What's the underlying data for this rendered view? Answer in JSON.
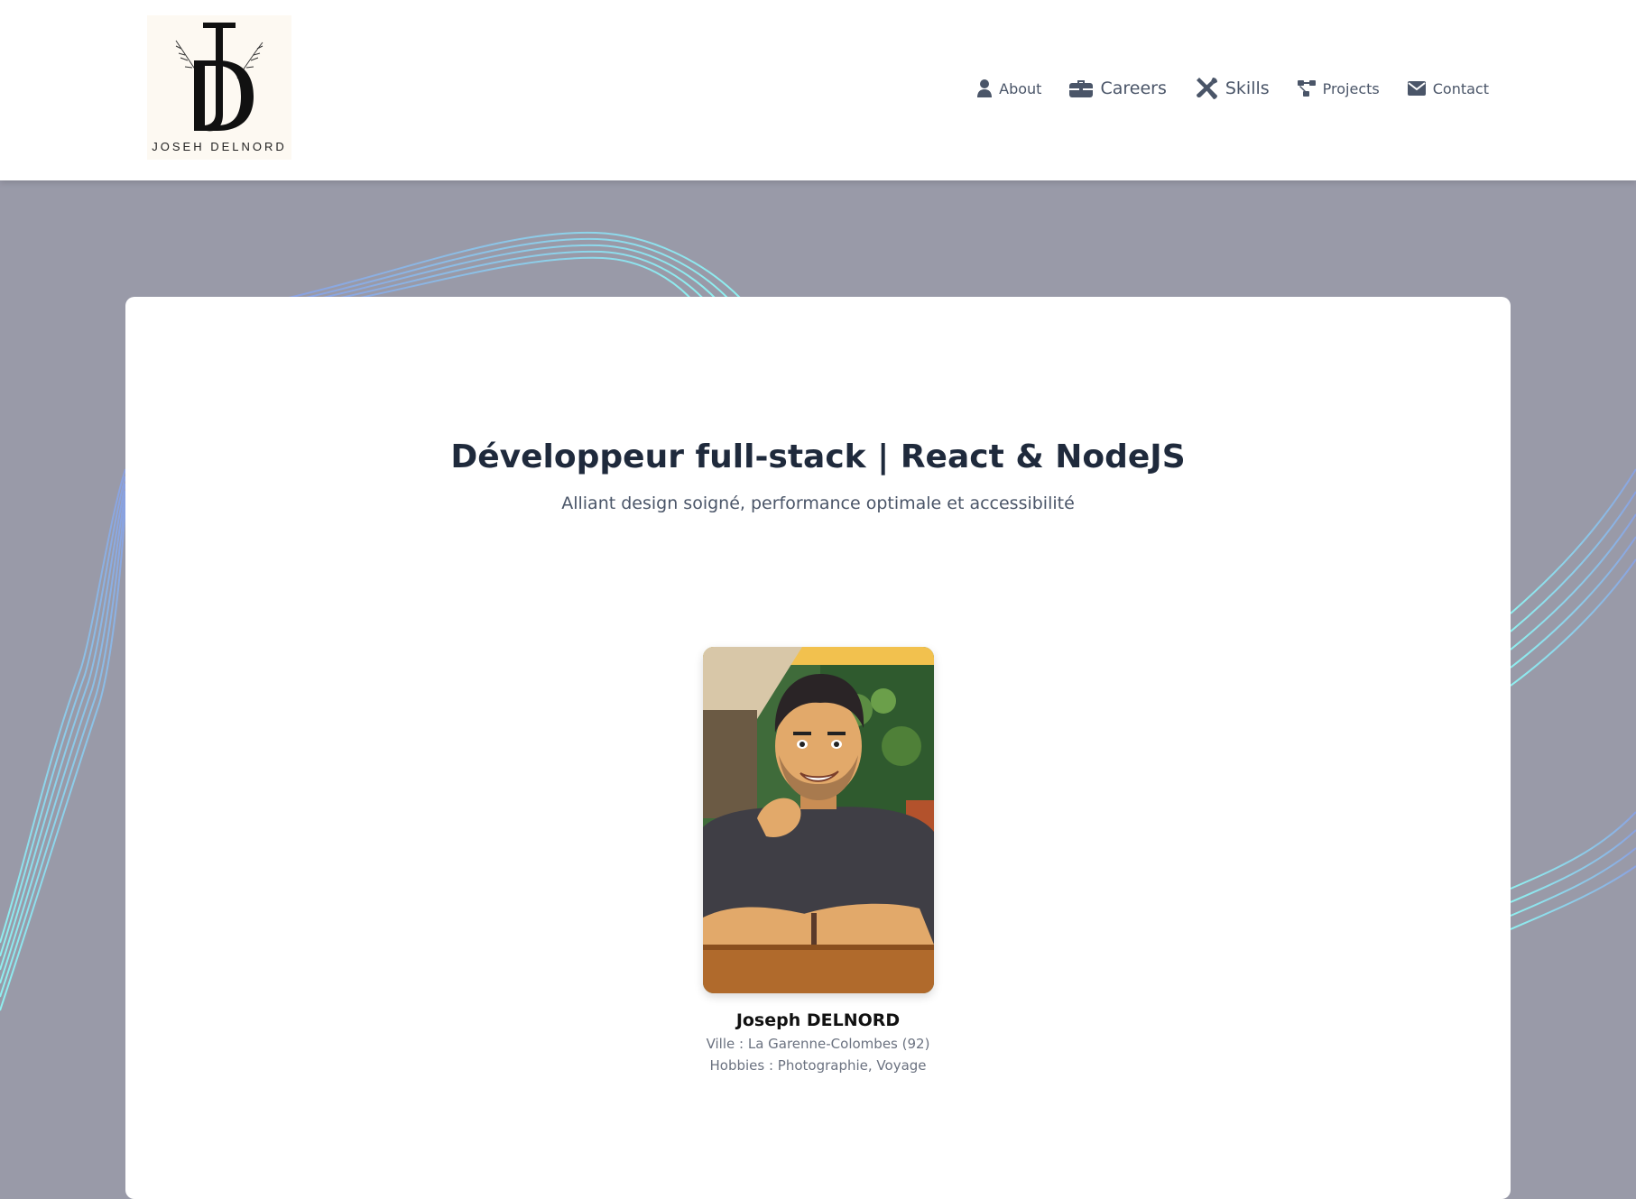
{
  "header": {
    "logo": {
      "initials": "JD",
      "name": "JOSEH DELNORD"
    },
    "nav": [
      {
        "label": "About",
        "icon": "user-icon"
      },
      {
        "label": "Careers",
        "icon": "briefcase-icon"
      },
      {
        "label": "Skills",
        "icon": "tools-icon"
      },
      {
        "label": "Projects",
        "icon": "diagram-icon"
      },
      {
        "label": "Contact",
        "icon": "envelope-icon"
      }
    ]
  },
  "hero": {
    "title": "Développeur full-stack | React & NodeJS",
    "subtitle": "Alliant design soigné, performance optimale et accessibilité"
  },
  "profile": {
    "name": "Joseph DELNORD",
    "city": "Ville : La Garenne-Colombes (92)",
    "hobbies": "Hobbies : Photographie, Voyage"
  },
  "colors": {
    "background": "#999aa8",
    "header": "#ffffff",
    "card": "#ffffff",
    "title": "#1f2a3c",
    "nav_text": "#4a5568",
    "wave_light": "#8ff0f0",
    "wave_blue": "#8aa0e0"
  }
}
